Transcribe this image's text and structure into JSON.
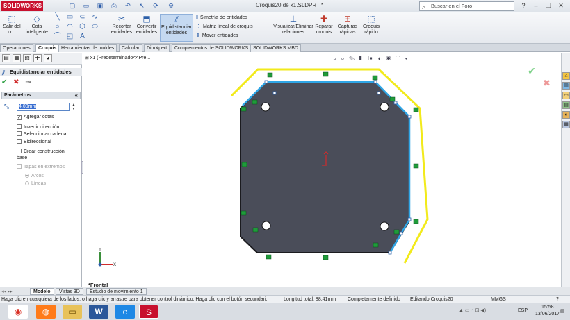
{
  "window": {
    "app": "SOLIDWORKS",
    "document_title": "Croquis20 de x1.SLDPRT *",
    "search_placeholder": "Buscar en el Foro"
  },
  "ribbon": {
    "exit_sketch": "Salir del cr...",
    "smart_dimension": "Cota inteligente",
    "trim": "Recortar entidades",
    "convert": "Convertir entidades",
    "offset": "Equidistanciar entidades",
    "mirror": "Simetría de entidades",
    "linear_pattern": "Matriz lineal de croquis",
    "move": "Mover entidades",
    "display_delete": "Visualizar/Eliminar relaciones",
    "repair": "Reparar croquis",
    "quick_snaps": "Capturas rápidas",
    "rapid_sketch": "Croquis rápido"
  },
  "tabs": [
    "Operaciones",
    "Croquis",
    "Herramientas de moldes",
    "Calcular",
    "DimXpert",
    "Complementos de SOLIDWORKS",
    "SOLIDWORKS MBD"
  ],
  "active_tab": "Croquis",
  "property_manager": {
    "title": "Equidistanciar entidades",
    "group": "Parámetros",
    "distance": "4.00mm",
    "options": [
      {
        "label": "Agregar cotas",
        "checked": true
      },
      {
        "label": "Invertir dirección",
        "checked": false
      },
      {
        "label": "Seleccionar cadena",
        "checked": false
      },
      {
        "label": "Bidireccional",
        "checked": false
      },
      {
        "label": "Crear construcción base",
        "checked": false
      }
    ],
    "caps_label": "Tapas en extremos",
    "radio_arcs": "Arcos",
    "radio_lines": "Líneas"
  },
  "viewport": {
    "breadcrumb": "x1  (Predeterminado<<Pre...",
    "view_name": "*Frontal",
    "colors": {
      "part_fill": "#4a4d59",
      "offset_preview": "#f2ea1b",
      "selected_edge": "#2fa6e6",
      "relation": "#1f9b3a"
    }
  },
  "bottom_tabs": [
    "Modelo",
    "Vistas 3D",
    "Estudio de movimiento 1"
  ],
  "status": {
    "hint": "Haga clic en cualquiera de los lados, o haga clic y arrastre para obtener control dinámico. Haga clic con el botón secundari...",
    "length": "Longitud total: 88.41mm",
    "definition": "Completamente definido",
    "editing": "Editando Croquis20",
    "units": "MMGS"
  },
  "taskbar": {
    "lang": "ESP",
    "time": "15:58",
    "date": "13/06/2017"
  }
}
